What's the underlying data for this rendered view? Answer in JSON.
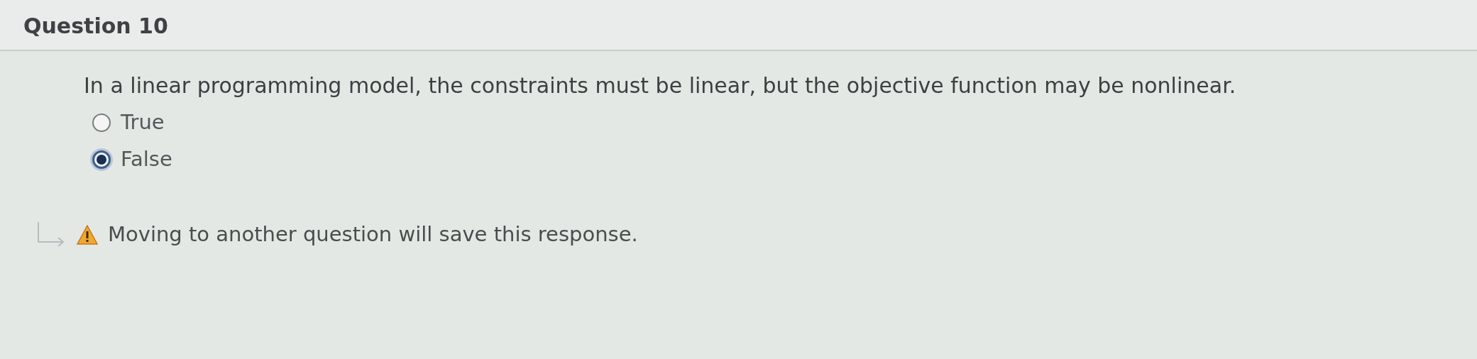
{
  "question": {
    "title": "Question 10",
    "text": "In a linear programming model, the constraints must be linear, but the objective function may be nonlinear.",
    "options": [
      {
        "label": "True",
        "selected": false
      },
      {
        "label": "False",
        "selected": true
      }
    ]
  },
  "notice": {
    "text": "Moving to another question will save this response."
  }
}
